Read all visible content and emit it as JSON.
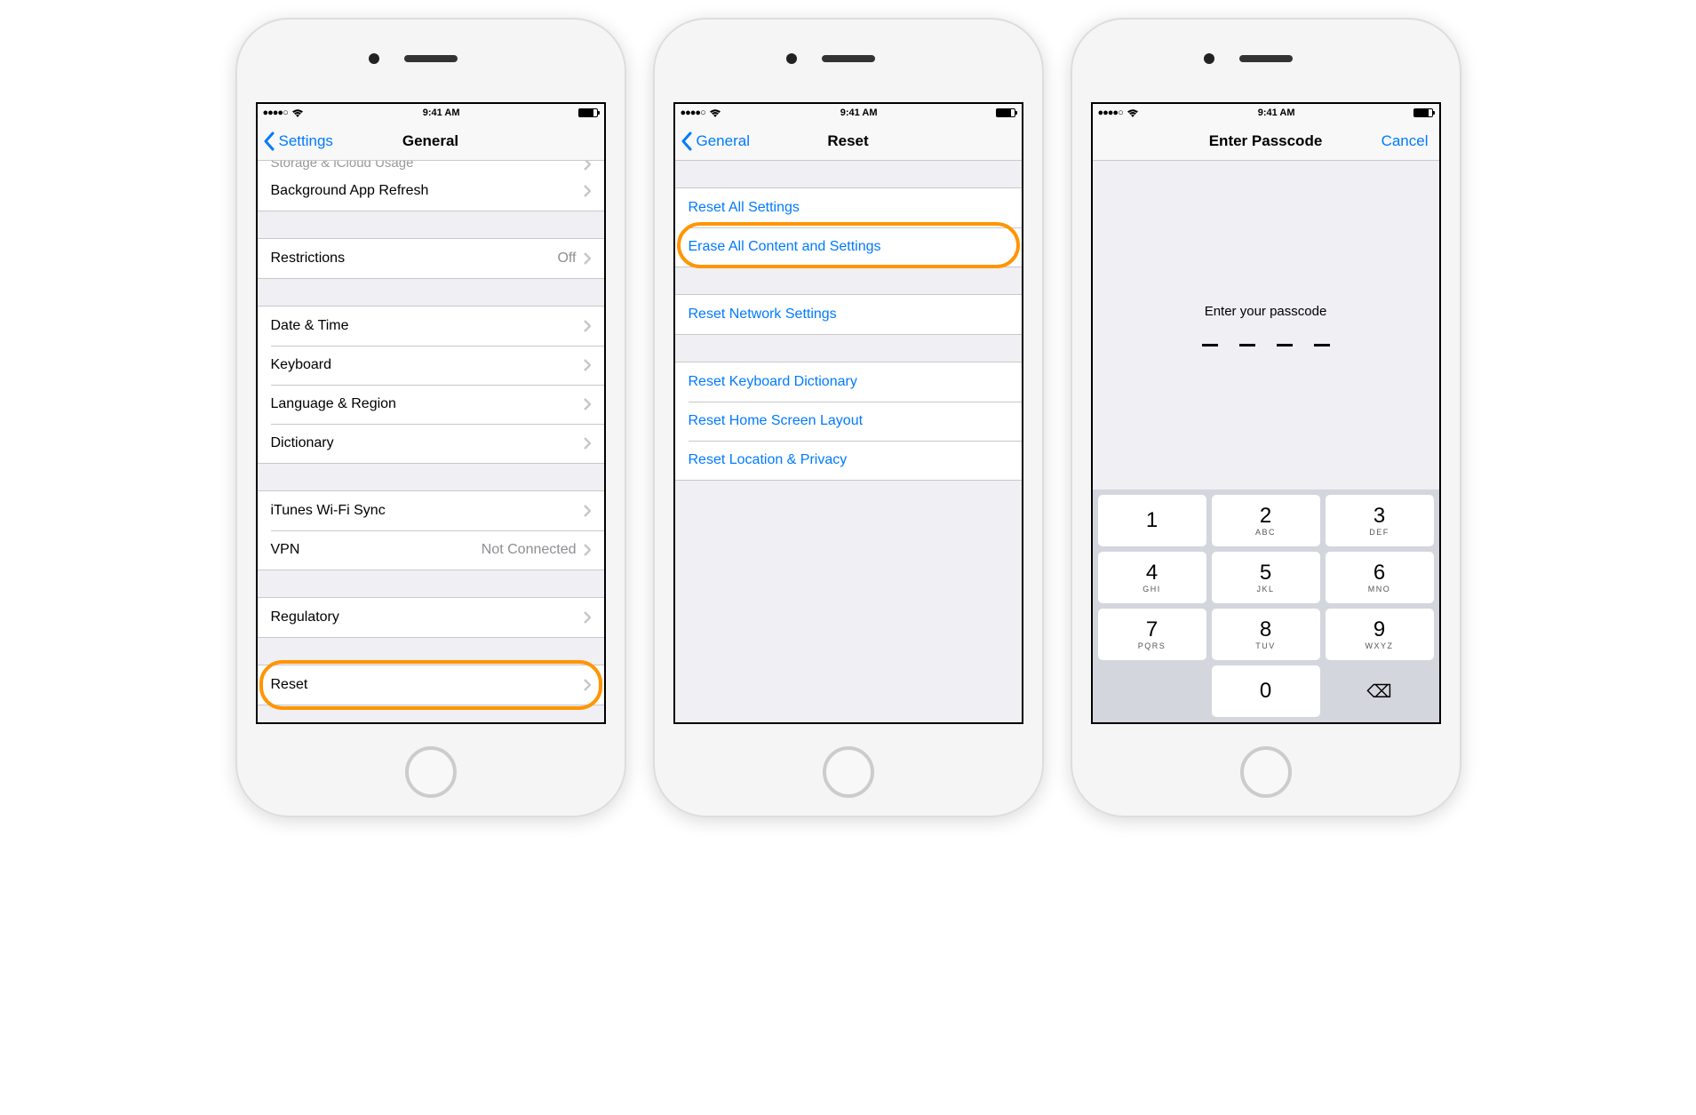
{
  "status": {
    "carrier_dots": "●●●●○",
    "wifi": "wifi-icon",
    "time": "9:41 AM",
    "battery_pct": 80
  },
  "screen1": {
    "back_label": "Settings",
    "title": "General",
    "cut_row": {
      "label": "Storage & iCloud Usage"
    },
    "rows": {
      "bg_refresh": "Background App Refresh",
      "restrictions": {
        "label": "Restrictions",
        "value": "Off"
      },
      "datetime": "Date & Time",
      "keyboard": "Keyboard",
      "langregion": "Language & Region",
      "dictionary": "Dictionary",
      "itunes": "iTunes Wi-Fi Sync",
      "vpn": {
        "label": "VPN",
        "value": "Not Connected"
      },
      "regulatory": "Regulatory",
      "reset": "Reset"
    }
  },
  "screen2": {
    "back_label": "General",
    "title": "Reset",
    "rows": {
      "reset_all": "Reset All Settings",
      "erase_all": "Erase All Content and Settings",
      "reset_network": "Reset Network Settings",
      "reset_keyboard": "Reset Keyboard Dictionary",
      "reset_home": "Reset Home Screen Layout",
      "reset_location": "Reset Location & Privacy"
    }
  },
  "screen3": {
    "title": "Enter Passcode",
    "cancel": "Cancel",
    "prompt": "Enter your passcode",
    "keys": [
      {
        "n": "1",
        "sub": ""
      },
      {
        "n": "2",
        "sub": "ABC"
      },
      {
        "n": "3",
        "sub": "DEF"
      },
      {
        "n": "4",
        "sub": "GHI"
      },
      {
        "n": "5",
        "sub": "JKL"
      },
      {
        "n": "6",
        "sub": "MNO"
      },
      {
        "n": "7",
        "sub": "PQRS"
      },
      {
        "n": "8",
        "sub": "TUV"
      },
      {
        "n": "9",
        "sub": "WXYZ"
      },
      {
        "n": "0",
        "sub": ""
      }
    ],
    "delete_glyph": "⌫"
  }
}
